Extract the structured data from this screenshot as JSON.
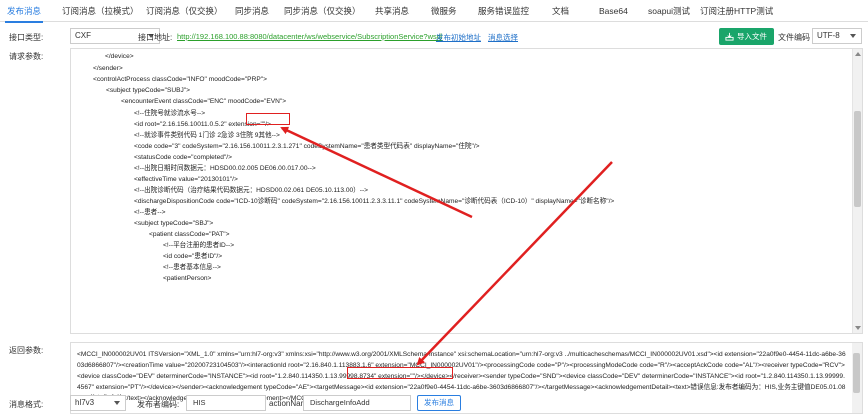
{
  "tabs": [
    {
      "label": "发布消息",
      "active": true
    },
    {
      "label": "订阅消息（拉模式）"
    },
    {
      "label": "订阅消息（仅交换）"
    },
    {
      "label": "同步消息"
    },
    {
      "label": "同步消息（仅交换）"
    },
    {
      "label": "共享消息"
    },
    {
      "label": "微服务"
    },
    {
      "label": "服务错误监控"
    },
    {
      "label": "文档"
    },
    {
      "label": "Base64"
    },
    {
      "label": "soapui测试"
    },
    {
      "label": "订阅注册HTTP测试"
    }
  ],
  "interface": {
    "type_label": "接口类型:",
    "type_value": "CXF",
    "address_label": "接口地址:",
    "address_url": "http://192.168.100.88:8080/datacenter/ws/webservice/SubscriptionService?wsdl",
    "link_publish": "发布初始地址",
    "link_history": "消息选择",
    "import_label": "导入文件",
    "encoding_label": "文件编码",
    "encoding_value": "UTF-8"
  },
  "request": {
    "label": "请求参数:",
    "lines": [
      "</device>",
      "</sender>",
      "<controlActProcess classCode=\"INFO\" moodCode=\"PRP\">",
      "<subject typeCode=\"SUBJ\">",
      "<encounterEvent classCode=\"ENC\" moodCode=\"EVN\">",
      "<!--住院号就诊流水号-->",
      "<id root=\"2.16.156.10011.0.5.2\" extension=\"\"/>",
      "<!--就诊事件类别代码 1门诊 2急诊 3住院 9其他-->",
      "<code code=\"3\" codeSystem=\"2.16.156.10011.2.3.1.271\" codeSystemName=\"患者类型代码表\" displayName=\"住院\"/>",
      "<statusCode code=\"completed\"/>",
      "<!--出院日期时间数据元：HDSD00.02.005    DE06.00.017.00-->",
      "<effectiveTime value=\"20130101\"/>",
      "<!--出院诊断代码（治疗结果代码数据元：HDSD00.02.061 DE05.10.113.00）-->",
      "<dischargeDispositionCode code=\"ICD-10诊断码\" codeSystem=\"2.16.156.10011.2.3.3.11.1\" codeSystemName=\"诊断代码表（ICD-10）\" displayName=\"诊断名称\"/>",
      "<!--患者-->",
      "<subject typeCode=\"SBJ\">",
      "<patient classCode=\"PAT\">",
      "<!--平台注册的患者ID-->",
      "<id code=\"患者ID\"/>",
      "<!--患者基本信息-->",
      "<patientPerson>"
    ]
  },
  "response": {
    "label": "返回参数:",
    "text": "<MCCI_IN000002UV01 ITSVersion=\"XML_1.0\" xmlns=\"urn:hl7-org:v3\" xmlns:xsi=\"http://www.w3.org/2001/XMLSchema-instance\" xsi:schemaLocation=\"urn:hl7-org:v3 ../multicacheschemas/MCCI_IN000002UV01.xsd\"><id extension=\"22a0f9e0-4454-11dc-a6be-3603d6866807\"/><creationTime value=\"20200723104503\"/><interactionId root=\"2.16.840.1.113883.1.6\" extension=\"MCCI_IN000002UV01\"/><processingCode code=\"P\"/><processingModeCode code=\"R\"/><acceptAckCode code=\"AL\"/><receiver typeCode=\"RCV\"><device classCode=\"DEV\" determinerCode=\"INSTANCE\"><id root=\"1.2.840.114350.1.13.99998.8734\" extension=\"\"/></device></receiver><sender typeCode=\"SND\"><device classCode=\"DEV\" determinerCode=\"INSTANCE\"><id root=\"1.2.840.114350.1.13.99999.4567\" extension=\"PT\"/></device></sender><acknowledgement typeCode=\"AE\"><targetMessage><id extension=\"22a0f9e0-4454-11dc-a6be-3603d6866807\"/></targetMessage><acknowledgementDetail><text>错误信息:发布者编码为：HIS,业务主键值DE05.01.081.02传入为空值</text></acknowledgementDetail></acknowledgement></MCCI_IN000002UV01>"
  },
  "footer": {
    "format_label": "消息格式:",
    "format_value": "hl7v3",
    "publisher_label": "发布者编码:",
    "publisher_value": "HIS",
    "action_label": "actionName:",
    "action_value": "DischargeInfoAdd",
    "send_label": "发布消息"
  },
  "colors": {
    "accent": "#2a7ee0",
    "import_button": "#1aa56a",
    "annotation": "#e02020",
    "url": "#2ca02c"
  }
}
